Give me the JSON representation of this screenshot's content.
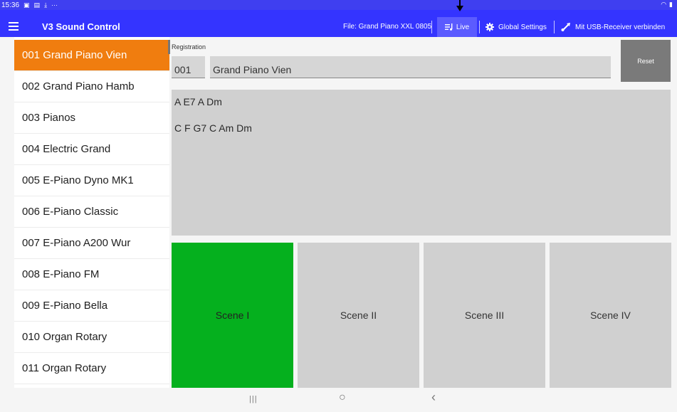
{
  "status_bar": {
    "time": "15:36",
    "icons": [
      "▣",
      "▤",
      "⤓",
      "···"
    ],
    "right_icons": [
      "◠",
      "▮"
    ]
  },
  "toolbar": {
    "app_title": "V3 Sound Control",
    "file_label": "File: Grand Piano XXL 0805",
    "live_label": "Live",
    "global_settings_label": "Global Settings",
    "usb_label": "Mit USB-Receiver verbinden"
  },
  "sidebar": {
    "items": [
      {
        "label": "001 Grand Piano Vien",
        "selected": true
      },
      {
        "label": "002 Grand Piano Hamb"
      },
      {
        "label": "003 Pianos"
      },
      {
        "label": "004 Electric Grand"
      },
      {
        "label": "005 E-Piano Dyno MK1"
      },
      {
        "label": "006 E-Piano Classic"
      },
      {
        "label": "007 E-Piano A200 Wur"
      },
      {
        "label": "008 E-Piano FM"
      },
      {
        "label": "009 E-Piano Bella"
      },
      {
        "label": "010 Organ Rotary"
      },
      {
        "label": "011 Organ Rotary"
      }
    ]
  },
  "registration": {
    "label": "Registration",
    "number": "001",
    "name": "Grand Piano Vien",
    "reset_label": "Reset"
  },
  "chords": {
    "line1": "A E7 A Dm",
    "line2": "C F G7 C Am Dm"
  },
  "scenes": [
    {
      "label": "Scene I",
      "active": true
    },
    {
      "label": "Scene II"
    },
    {
      "label": "Scene III"
    },
    {
      "label": "Scene IV"
    }
  ],
  "nav": {
    "recents": "|||",
    "home": "○",
    "back": "‹"
  },
  "colors": {
    "toolbar": "#3434ff",
    "selected_item": "#f07d0f",
    "active_scene": "#05b01e",
    "reset_button": "#7a7a7a"
  }
}
